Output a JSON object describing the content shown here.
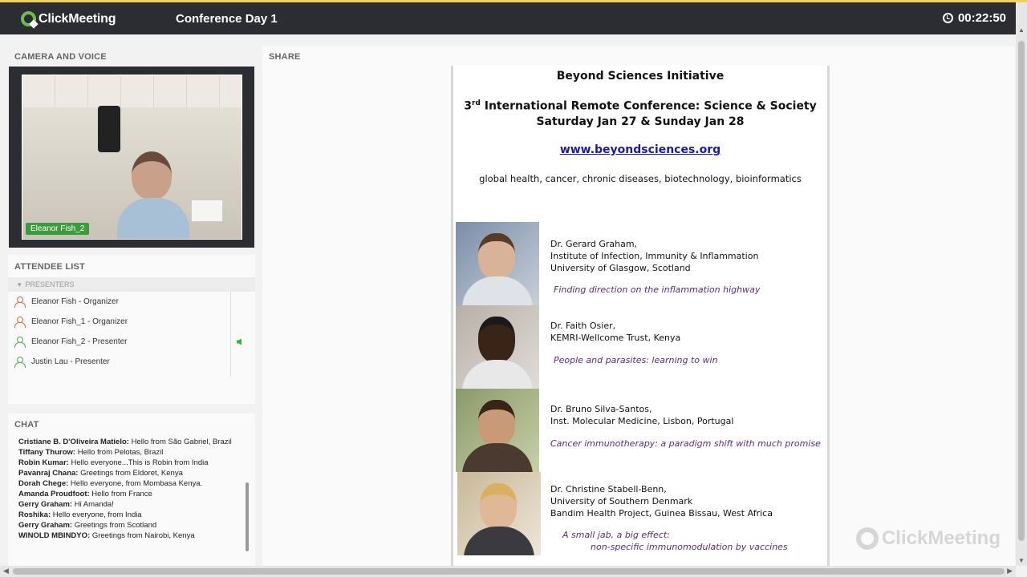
{
  "app": {
    "brand": "ClickMeeting",
    "conference_title": "Conference Day 1",
    "timer": "00:22:50"
  },
  "camera": {
    "section_label": "CAMERA AND VOICE",
    "name_tag": "Eleanor Fish_2"
  },
  "attendees": {
    "section_label": "ATTENDEE LIST",
    "group_label": "PRESENTERS",
    "items": [
      {
        "label": "Eleanor Fish  - Organizer",
        "role": "organizer"
      },
      {
        "label": "Eleanor Fish_1  - Organizer",
        "role": "organizer"
      },
      {
        "label": "Eleanor Fish_2  - Presenter",
        "role": "presenter"
      },
      {
        "label": "Justin Lau  - Presenter",
        "role": "presenter"
      }
    ]
  },
  "chat": {
    "section_label": "CHAT",
    "messages": [
      {
        "author": "Cristiane B. D'Oliveira Matielo:",
        "text": " Hello from São Gabriel, Brazil"
      },
      {
        "author": "Tiffany Thurow:",
        "text": " Hello from Pelotas, Brazil"
      },
      {
        "author": "Robin Kumar:",
        "text": " Hello everyone...This is Robin from India"
      },
      {
        "author": "Pavanraj Chana:",
        "text": " Greetings from Eldoret, Kenya"
      },
      {
        "author": "Dorah Chege:",
        "text": " Hello everyone,  from Mombasa Kenya."
      },
      {
        "author": "Amanda Proudfoot:",
        "text": " Hello from France"
      },
      {
        "author": "Gerry Graham:",
        "text": " Hi Amanda!"
      },
      {
        "author": "Roshika:",
        "text": " Hello everyone, from India"
      },
      {
        "author": "Gerry Graham:",
        "text": " Greetings from Scotland"
      },
      {
        "author": "WINOLD MBINDYO:",
        "text": " Greetings from Nairobi, Kenya"
      }
    ]
  },
  "share": {
    "section_label": "SHARE",
    "slide": {
      "title": "Beyond Sciences Initiative",
      "subtitle_ordinal": "3",
      "subtitle_sup": "rd",
      "subtitle_line1": " International Remote Conference: Science & Society",
      "subtitle_line2": "Saturday Jan 27 & Sunday Jan 28",
      "url": "www.beyondsciences.org",
      "topics": "global health, cancer, chronic diseases, biotechnology, bioinformatics",
      "speakers": [
        {
          "line1": "Dr. Gerard Graham,",
          "line2": "Institute of Infection, Immunity & Inflammation",
          "line3": "University of Glasgow, Scotland",
          "talk1": "Finding direction on the inflammation highway",
          "talk2": ""
        },
        {
          "line1": "Dr. Faith Osier,",
          "line2": "KEMRI-Wellcome Trust, Kenya",
          "line3": "",
          "talk1": "People and parasites: learning to win",
          "talk2": ""
        },
        {
          "line1": "Dr. Bruno Silva-Santos,",
          "line2": "Inst. Molecular Medicine, Lisbon, Portugal",
          "line3": "",
          "talk1": "Cancer immunotherapy: a paradigm shift with much promise",
          "talk2": ""
        },
        {
          "line1": "Dr. Christine Stabell-Benn,",
          "line2": "University of Southern Denmark",
          "line3": "Bandim Health Project, Guinea Bissau, West Africa",
          "talk1": "A small jab, a big effect:",
          "talk2": "non-specific  immunomodulation by vaccines"
        }
      ]
    },
    "watermark": "ClickMeeting"
  },
  "colors": {
    "topbar": "#2b2d33",
    "brand_green": "#6cc04a",
    "organizer_icon": "#e06a3a",
    "presenter_icon": "#4caf50",
    "talk_title": "#5a2a7a",
    "link": "#1a1aaa"
  }
}
